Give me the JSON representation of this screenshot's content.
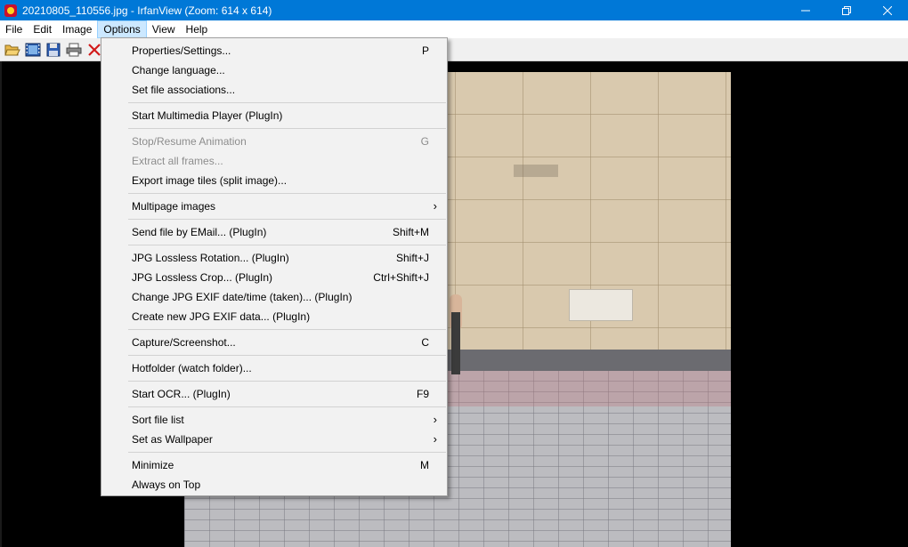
{
  "window": {
    "title": "20210805_110556.jpg - IrfanView (Zoom: 614 x 614)"
  },
  "menubar": {
    "items": [
      "File",
      "Edit",
      "Image",
      "Options",
      "View",
      "Help"
    ],
    "active": "Options"
  },
  "toolbar": {
    "icons": [
      "open-folder-icon",
      "filmstrip-icon",
      "save-icon",
      "print-icon",
      "delete-icon"
    ]
  },
  "options_menu": {
    "groups": [
      [
        {
          "label": "Properties/Settings...",
          "shortcut": "P",
          "enabled": true
        },
        {
          "label": "Change language...",
          "shortcut": "",
          "enabled": true
        },
        {
          "label": "Set file associations...",
          "shortcut": "",
          "enabled": true
        }
      ],
      [
        {
          "label": "Start Multimedia Player (PlugIn)",
          "shortcut": "",
          "enabled": true
        }
      ],
      [
        {
          "label": "Stop/Resume Animation",
          "shortcut": "G",
          "enabled": false
        },
        {
          "label": "Extract all frames...",
          "shortcut": "",
          "enabled": false
        },
        {
          "label": "Export image tiles (split image)...",
          "shortcut": "",
          "enabled": true
        }
      ],
      [
        {
          "label": "Multipage images",
          "shortcut": "",
          "enabled": true,
          "submenu": true
        }
      ],
      [
        {
          "label": "Send file by EMail... (PlugIn)",
          "shortcut": "Shift+M",
          "enabled": true
        }
      ],
      [
        {
          "label": "JPG Lossless Rotation... (PlugIn)",
          "shortcut": "Shift+J",
          "enabled": true
        },
        {
          "label": "JPG Lossless Crop... (PlugIn)",
          "shortcut": "Ctrl+Shift+J",
          "enabled": true
        },
        {
          "label": "Change JPG EXIF date/time (taken)... (PlugIn)",
          "shortcut": "",
          "enabled": true
        },
        {
          "label": "Create new JPG EXIF data... (PlugIn)",
          "shortcut": "",
          "enabled": true
        }
      ],
      [
        {
          "label": "Capture/Screenshot...",
          "shortcut": "C",
          "enabled": true
        }
      ],
      [
        {
          "label": "Hotfolder (watch folder)...",
          "shortcut": "",
          "enabled": true
        }
      ],
      [
        {
          "label": "Start OCR... (PlugIn)",
          "shortcut": "F9",
          "enabled": true
        }
      ],
      [
        {
          "label": "Sort file list",
          "shortcut": "",
          "enabled": true,
          "submenu": true
        },
        {
          "label": "Set as Wallpaper",
          "shortcut": "",
          "enabled": true,
          "submenu": true
        }
      ],
      [
        {
          "label": "Minimize",
          "shortcut": "M",
          "enabled": true
        },
        {
          "label": "Always on Top",
          "shortcut": "",
          "enabled": true
        }
      ]
    ]
  },
  "colors": {
    "titlebar": "#0078d7",
    "menu_bg": "#f2f2f2",
    "menu_active": "#cce8ff",
    "disabled_text": "#8d8d8d"
  }
}
